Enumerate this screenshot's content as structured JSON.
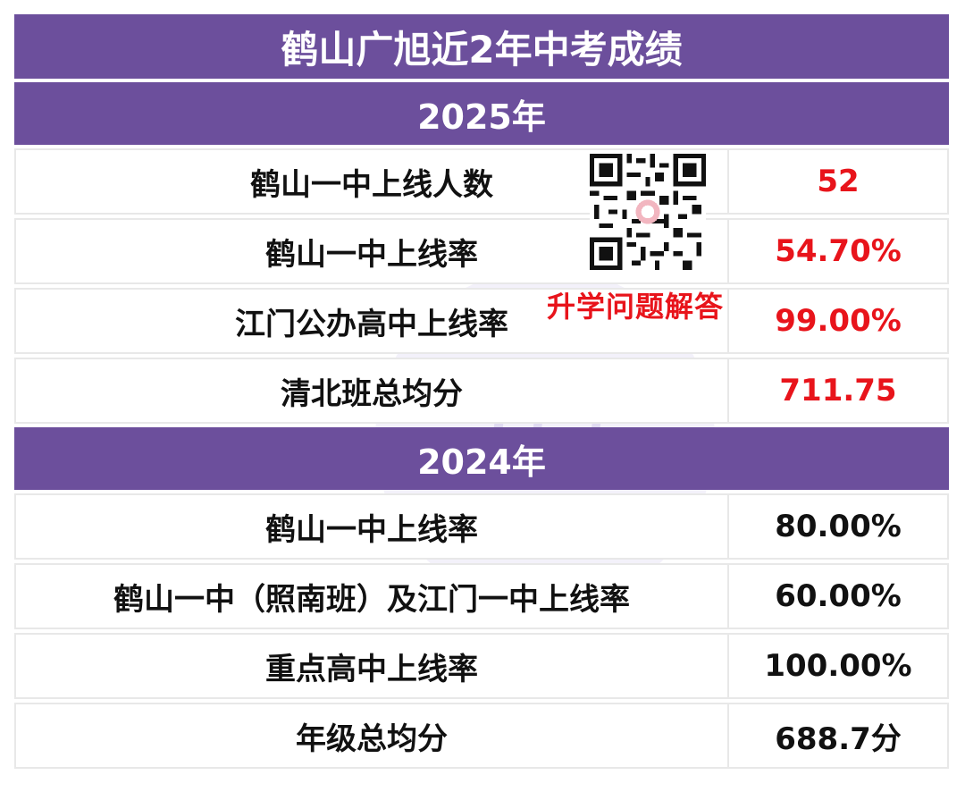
{
  "title": "鹤山广旭近2年中考成绩",
  "sections": [
    {
      "year": "2025年",
      "rows": [
        {
          "label": "鹤山一中上线人数",
          "value": "52"
        },
        {
          "label": "鹤山一中上线率",
          "value": "54.70%"
        },
        {
          "label": "江门公办高中上线率",
          "value": "99.00%"
        },
        {
          "label": "清北班总均分",
          "value": "711.75"
        }
      ]
    },
    {
      "year": "2024年",
      "rows": [
        {
          "label": "鹤山一中上线率",
          "value": "80.00%"
        },
        {
          "label": "鹤山一中（照南班）及江门一中上线率",
          "value": "60.00%"
        },
        {
          "label": "重点高中上线率",
          "value": "100.00%"
        },
        {
          "label": "年级总均分",
          "value": "688.7分"
        }
      ]
    }
  ],
  "qr_caption": "升学问题解答",
  "watermark_text": "江门",
  "colors": {
    "header_bg": "#6c4f9c",
    "header_text": "#ffffff",
    "highlight_value": "#e8141b",
    "normal_value": "#111111"
  }
}
